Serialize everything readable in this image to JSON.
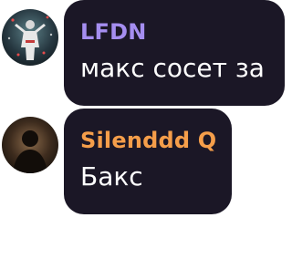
{
  "messages": [
    {
      "author": "LFDN",
      "text": "макс сосет за",
      "author_color": "#a58ef0",
      "avatar": "user-avatar-1"
    },
    {
      "author": "Silenddd Q",
      "text": "Бакс",
      "author_color": "#f59e4a",
      "avatar": "user-avatar-2"
    }
  ],
  "theme": {
    "bubble_color": "#1b1726",
    "text_color": "#ffffff",
    "page_background": "#ffffff"
  }
}
